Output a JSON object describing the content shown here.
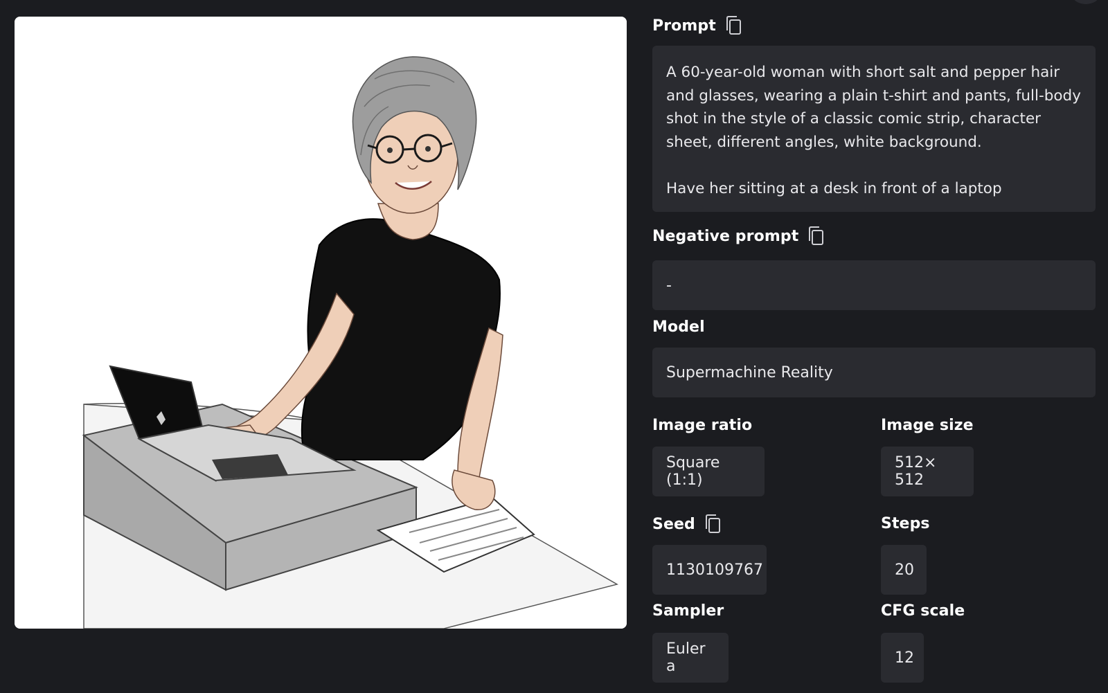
{
  "details": {
    "prompt": {
      "label": "Prompt",
      "paragraphs": [
        "A 60-year-old woman with short salt and pepper hair and glasses, wearing a plain t-shirt and pants, full-body shot in the style of a classic comic strip, character sheet, different angles, white background.",
        "Have her sitting at a desk in front of a laptop"
      ]
    },
    "negative_prompt": {
      "label": "Negative prompt",
      "value": "-"
    },
    "model": {
      "label": "Model",
      "value": "Supermachine Reality"
    },
    "image_ratio": {
      "label": "Image ratio",
      "value": "Square (1:1)"
    },
    "image_size": {
      "label": "Image size",
      "value": "512× 512"
    },
    "seed": {
      "label": "Seed",
      "value": "1130109767"
    },
    "steps": {
      "label": "Steps",
      "value": "20"
    },
    "sampler": {
      "label": "Sampler",
      "value": "Euler a"
    },
    "cfg_scale": {
      "label": "CFG scale",
      "value": "12"
    }
  },
  "icons": {
    "copy": "copy-icon"
  }
}
